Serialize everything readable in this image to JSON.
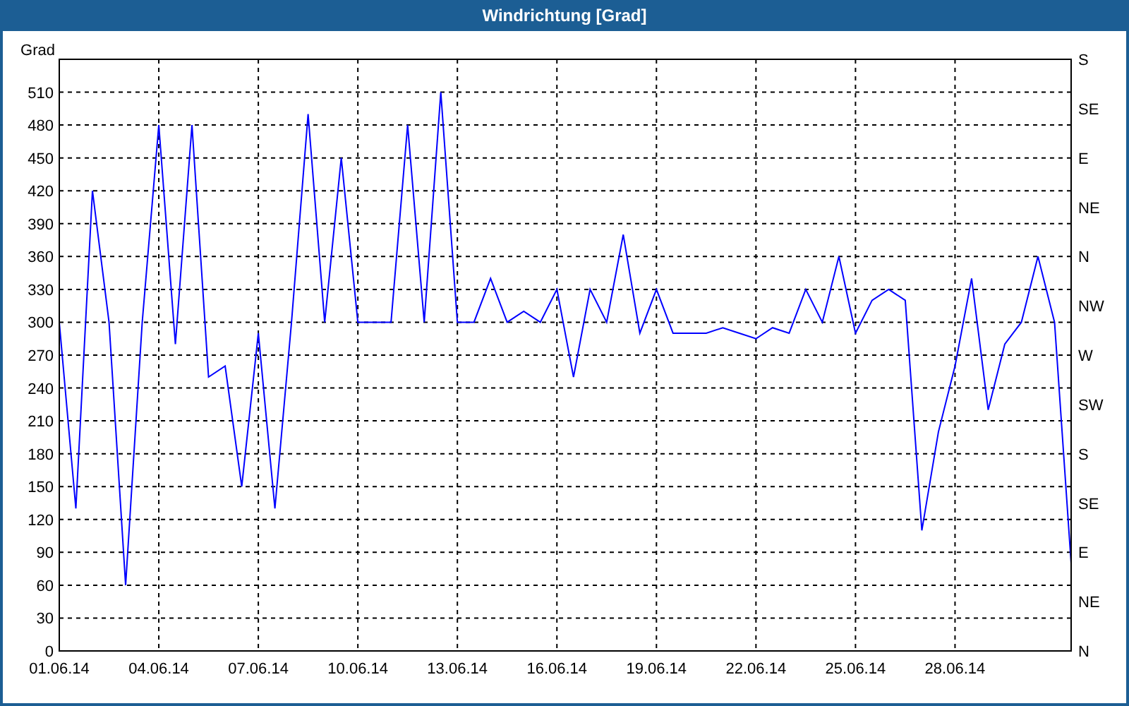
{
  "window": {
    "title": "Windrichtung [Grad]"
  },
  "chart": {
    "right_axis_labels": [
      "S",
      "SE",
      "E",
      "NE",
      "N",
      "NW",
      "W",
      "SW",
      "S",
      "SE",
      "E",
      "NE",
      "N"
    ],
    "chart_data": {
      "type": "line",
      "ylabel": "Grad",
      "categories": [
        "01.06.14",
        null,
        null,
        null,
        null,
        null,
        "04.06.14",
        null,
        null,
        null,
        null,
        null,
        "07.06.14",
        null,
        null,
        null,
        null,
        null,
        "10.06.14",
        null,
        null,
        null,
        null,
        null,
        "13.06.14",
        null,
        null,
        null,
        null,
        null,
        "16.06.14",
        null,
        null,
        null,
        null,
        null,
        "19.06.14",
        null,
        null,
        null,
        null,
        null,
        "22.06.14",
        null,
        null,
        null,
        null,
        null,
        "25.06.14",
        null,
        null,
        null,
        null,
        null,
        "28.06.14",
        null,
        null,
        null,
        null,
        null,
        null,
        null
      ],
      "series": [
        {
          "color": "#0000ff",
          "values": [
            300,
            130,
            420,
            300,
            60,
            300,
            480,
            280,
            480,
            250,
            260,
            150,
            290,
            130,
            300,
            490,
            300,
            450,
            300,
            300,
            300,
            480,
            300,
            510,
            300,
            300,
            340,
            300,
            310,
            300,
            330,
            250,
            330,
            300,
            380,
            290,
            330,
            290,
            290,
            290,
            295,
            290,
            285,
            295,
            290,
            330,
            300,
            360,
            290,
            320,
            330,
            320,
            110,
            200,
            260,
            340,
            220,
            280,
            300,
            360,
            300,
            80
          ]
        }
      ],
      "grid": true,
      "ylim": [
        0,
        540
      ],
      "yticks": [
        0,
        30,
        60,
        90,
        120,
        150,
        180,
        210,
        240,
        270,
        300,
        330,
        360,
        390,
        420,
        450,
        480,
        510
      ]
    }
  }
}
